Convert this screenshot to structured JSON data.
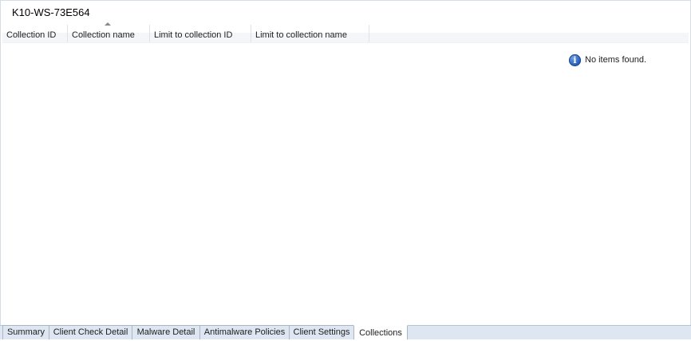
{
  "panel": {
    "title": "K10-WS-73E564"
  },
  "columns": [
    {
      "label": "Collection ID"
    },
    {
      "label": "Collection name"
    },
    {
      "label": "Limit to collection ID"
    },
    {
      "label": "Limit to collection name"
    }
  ],
  "sort": {
    "column": "Collection name",
    "icon": "sort-ascending-icon"
  },
  "list": {
    "empty_message": "No items found.",
    "empty_icon": "info-icon",
    "empty_icon_glyph": "i",
    "empty_icon_color": "#2c62bb"
  },
  "tabs": [
    {
      "label": "Summary",
      "active": false
    },
    {
      "label": "Client Check Detail",
      "active": false
    },
    {
      "label": "Malware Detail",
      "active": false
    },
    {
      "label": "Antimalware Policies",
      "active": false
    },
    {
      "label": "Client Settings",
      "active": false
    },
    {
      "label": "Collections",
      "active": true
    }
  ],
  "colors": {
    "tabbar_background": "#dde6f1",
    "active_tab_background": "#ffffff",
    "border": "#a9b6c6"
  }
}
